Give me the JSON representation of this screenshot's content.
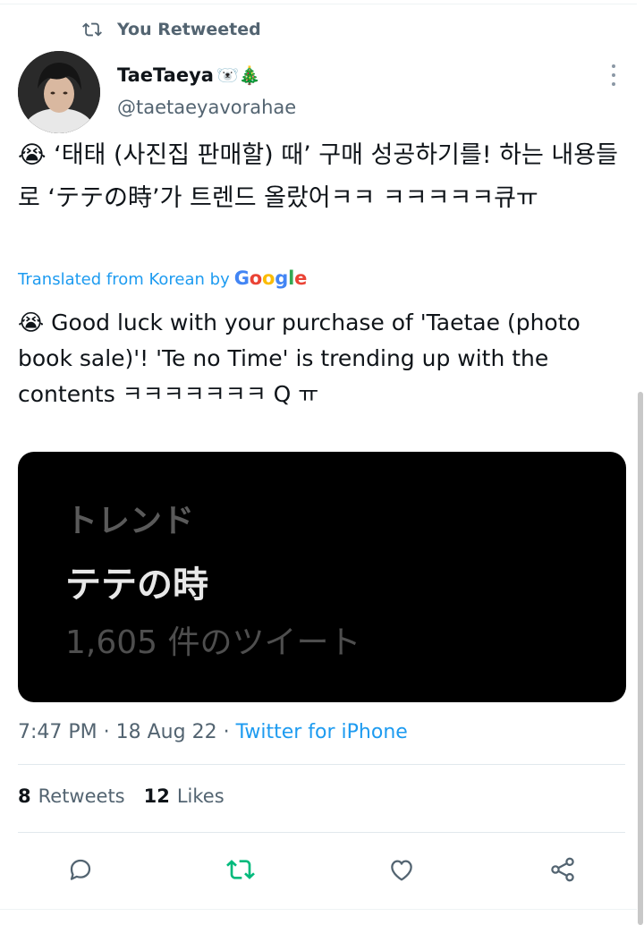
{
  "retweet_header": {
    "icon": "retweet-icon",
    "label": "You Retweeted"
  },
  "author": {
    "name": "TaeTaeya",
    "name_emojis": "🐻‍❄️🎄",
    "handle": "@taetaeyavorahae"
  },
  "tweet": {
    "text": "😭 ‘태태 (사진집 판매할) 때’ 구매 성공하기를! 하는 내용들로 ‘テテの時’가 트렌드 올랐어ㅋㅋ ㅋㅋㅋㅋㅋ큐ㅠ",
    "translated_label": "Translated from Korean by",
    "translator_brand": [
      "G",
      "o",
      "o",
      "g",
      "l",
      "e"
    ],
    "translation": "😭 Good luck with your purchase of 'Taetae (photo book sale)'! 'Te no Time' is trending up with the contents ㅋㅋㅋㅋㅋㅋㅋ Q ㅠ"
  },
  "media": {
    "line1": "トレンド",
    "line2": "テテの時",
    "line3": "1,605 件のツイート"
  },
  "meta": {
    "time": "7:47 PM",
    "separator1": " · ",
    "date": "18 Aug 22",
    "separator2": " · ",
    "source": "Twitter for iPhone"
  },
  "stats": {
    "retweets_count": "8",
    "retweets_label": "Retweets",
    "likes_count": "12",
    "likes_label": "Likes"
  },
  "actions": [
    "reply-icon",
    "retweet-icon",
    "like-icon",
    "share-icon"
  ],
  "colors": {
    "accent": "#1d9bf0",
    "retweet_active": "#00ba7c",
    "secondary_text": "#536471"
  }
}
